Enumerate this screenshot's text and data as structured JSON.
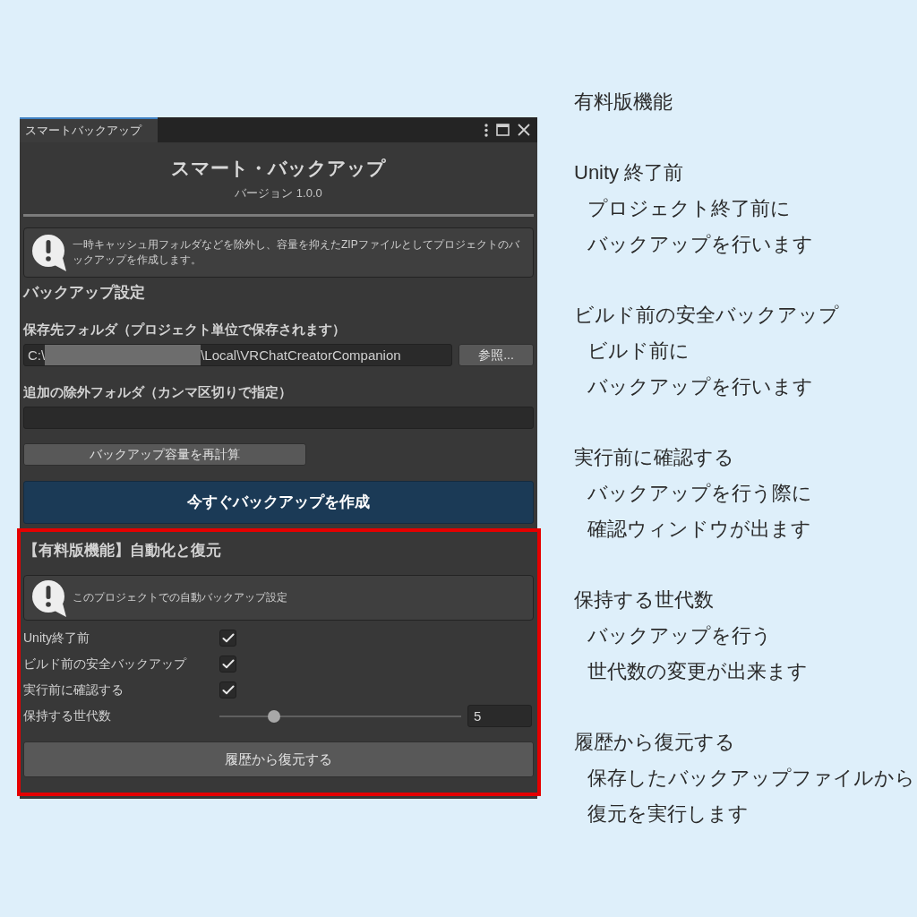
{
  "editor_window": {
    "tabs": [
      {
        "label": "スマートバックアップ",
        "selected": true
      }
    ],
    "header": {
      "title": "スマート・バックアップ",
      "version": "バージョン 1.0.0"
    },
    "intro_help": "一時キャッシュ用フォルダなどを除外し、容量を抑えたZIPファイルとしてプロジェクトのバックアップを作成します。",
    "backup_settings": {
      "heading": "バックアップ設定",
      "destination_label": "保存先フォルダ（プロジェクト単位で保存されます）",
      "destination_path": {
        "visible_start": "C:\\",
        "visible_end": "\\Local\\VRChatCreatorCompanion"
      },
      "browse_button": "参照...",
      "exclude_label": "追加の除外フォルダ（カンマ区切りで指定）",
      "recalculate_button": "バックアップ容量を再計算",
      "backup_now_button": "今すぐバックアップを作成"
    },
    "premium_section": {
      "highlighted": true,
      "heading": "【有料版機能】自動化と復元",
      "help": "このプロジェクトでの自動バックアップ設定",
      "settings": [
        {
          "kind": "checkbox",
          "label": "Unity終了前",
          "checked": true
        },
        {
          "kind": "checkbox",
          "label": "ビルド前の安全バックアップ",
          "checked": true
        },
        {
          "kind": "checkbox",
          "label": "実行前に確認する",
          "checked": true
        },
        {
          "kind": "slider",
          "label": "保持する世代数",
          "level": 0.21,
          "value": "5"
        }
      ],
      "restore_button": "履歴から復元する"
    }
  },
  "annotations": {
    "title": "有料版機能",
    "items": [
      {
        "heading": "Unity 終了前",
        "lines": [
          "プロジェクト終了前に",
          "バックアップを行います"
        ]
      },
      {
        "heading": "ビルド前の安全バックアップ",
        "lines": [
          "ビルド前に",
          "バックアップを行います"
        ]
      },
      {
        "heading": "実行前に確認する",
        "lines": [
          "バックアップを行う際に",
          "確認ウィンドウが出ます"
        ]
      },
      {
        "heading": "保持する世代数",
        "lines": [
          "バックアップを行う",
          "世代数の変更が出来ます"
        ]
      },
      {
        "heading": "履歴から復元する",
        "lines": [
          "保存したバックアップファイルから",
          "復元を実行します"
        ]
      }
    ]
  }
}
